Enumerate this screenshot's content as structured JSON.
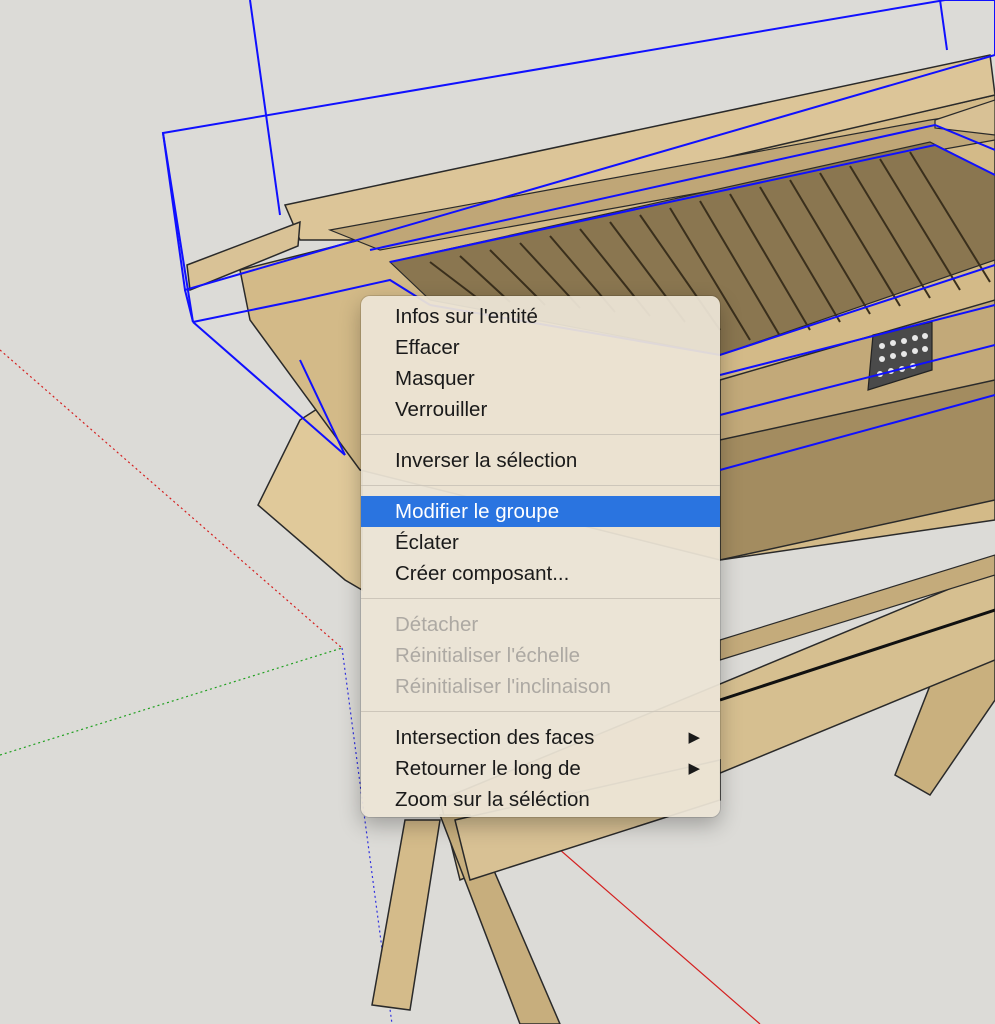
{
  "context_menu": {
    "groups": [
      [
        {
          "label": "Infos sur l'entité",
          "state": "enabled"
        },
        {
          "label": "Effacer",
          "state": "enabled"
        },
        {
          "label": "Masquer",
          "state": "enabled"
        },
        {
          "label": "Verrouiller",
          "state": "enabled"
        }
      ],
      [
        {
          "label": "Inverser la sélection",
          "state": "enabled"
        }
      ],
      [
        {
          "label": "Modifier le groupe",
          "state": "selected"
        },
        {
          "label": "Éclater",
          "state": "enabled"
        },
        {
          "label": "Créer composant...",
          "state": "enabled"
        }
      ],
      [
        {
          "label": "Détacher",
          "state": "disabled"
        },
        {
          "label": "Réinitialiser l'échelle",
          "state": "disabled"
        },
        {
          "label": "Réinitialiser l'inclinaison",
          "state": "disabled"
        }
      ],
      [
        {
          "label": "Intersection des faces",
          "state": "enabled",
          "submenu": true
        },
        {
          "label": "Retourner le long de",
          "state": "enabled",
          "submenu": true
        },
        {
          "label": "Zoom sur la séléction",
          "state": "enabled"
        }
      ]
    ],
    "submenu_arrow_icon": "triangle-right-icon"
  },
  "colors": {
    "background": "#dcdbd7",
    "menu_background": "#ece4d6",
    "highlight": "#2a74e0",
    "selection_bbox": "#1010ff",
    "wood_light": "#d9c193",
    "wood_mid": "#bba272",
    "wood_dark": "#8b774f",
    "axis_red": "#d42020",
    "axis_green": "#20a020",
    "axis_blue": "#3030e0"
  }
}
